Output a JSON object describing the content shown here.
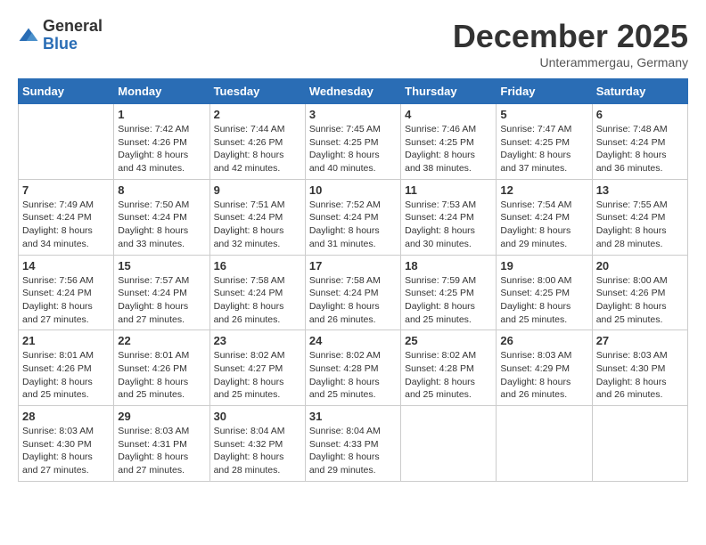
{
  "logo": {
    "general": "General",
    "blue": "Blue"
  },
  "title": "December 2025",
  "subtitle": "Unterammergau, Germany",
  "weekdays": [
    "Sunday",
    "Monday",
    "Tuesday",
    "Wednesday",
    "Thursday",
    "Friday",
    "Saturday"
  ],
  "weeks": [
    [
      {
        "day": "",
        "info": ""
      },
      {
        "day": "1",
        "info": "Sunrise: 7:42 AM\nSunset: 4:26 PM\nDaylight: 8 hours\nand 43 minutes."
      },
      {
        "day": "2",
        "info": "Sunrise: 7:44 AM\nSunset: 4:26 PM\nDaylight: 8 hours\nand 42 minutes."
      },
      {
        "day": "3",
        "info": "Sunrise: 7:45 AM\nSunset: 4:25 PM\nDaylight: 8 hours\nand 40 minutes."
      },
      {
        "day": "4",
        "info": "Sunrise: 7:46 AM\nSunset: 4:25 PM\nDaylight: 8 hours\nand 38 minutes."
      },
      {
        "day": "5",
        "info": "Sunrise: 7:47 AM\nSunset: 4:25 PM\nDaylight: 8 hours\nand 37 minutes."
      },
      {
        "day": "6",
        "info": "Sunrise: 7:48 AM\nSunset: 4:24 PM\nDaylight: 8 hours\nand 36 minutes."
      }
    ],
    [
      {
        "day": "7",
        "info": "Sunrise: 7:49 AM\nSunset: 4:24 PM\nDaylight: 8 hours\nand 34 minutes."
      },
      {
        "day": "8",
        "info": "Sunrise: 7:50 AM\nSunset: 4:24 PM\nDaylight: 8 hours\nand 33 minutes."
      },
      {
        "day": "9",
        "info": "Sunrise: 7:51 AM\nSunset: 4:24 PM\nDaylight: 8 hours\nand 32 minutes."
      },
      {
        "day": "10",
        "info": "Sunrise: 7:52 AM\nSunset: 4:24 PM\nDaylight: 8 hours\nand 31 minutes."
      },
      {
        "day": "11",
        "info": "Sunrise: 7:53 AM\nSunset: 4:24 PM\nDaylight: 8 hours\nand 30 minutes."
      },
      {
        "day": "12",
        "info": "Sunrise: 7:54 AM\nSunset: 4:24 PM\nDaylight: 8 hours\nand 29 minutes."
      },
      {
        "day": "13",
        "info": "Sunrise: 7:55 AM\nSunset: 4:24 PM\nDaylight: 8 hours\nand 28 minutes."
      }
    ],
    [
      {
        "day": "14",
        "info": "Sunrise: 7:56 AM\nSunset: 4:24 PM\nDaylight: 8 hours\nand 27 minutes."
      },
      {
        "day": "15",
        "info": "Sunrise: 7:57 AM\nSunset: 4:24 PM\nDaylight: 8 hours\nand 27 minutes."
      },
      {
        "day": "16",
        "info": "Sunrise: 7:58 AM\nSunset: 4:24 PM\nDaylight: 8 hours\nand 26 minutes."
      },
      {
        "day": "17",
        "info": "Sunrise: 7:58 AM\nSunset: 4:24 PM\nDaylight: 8 hours\nand 26 minutes."
      },
      {
        "day": "18",
        "info": "Sunrise: 7:59 AM\nSunset: 4:25 PM\nDaylight: 8 hours\nand 25 minutes."
      },
      {
        "day": "19",
        "info": "Sunrise: 8:00 AM\nSunset: 4:25 PM\nDaylight: 8 hours\nand 25 minutes."
      },
      {
        "day": "20",
        "info": "Sunrise: 8:00 AM\nSunset: 4:26 PM\nDaylight: 8 hours\nand 25 minutes."
      }
    ],
    [
      {
        "day": "21",
        "info": "Sunrise: 8:01 AM\nSunset: 4:26 PM\nDaylight: 8 hours\nand 25 minutes."
      },
      {
        "day": "22",
        "info": "Sunrise: 8:01 AM\nSunset: 4:26 PM\nDaylight: 8 hours\nand 25 minutes."
      },
      {
        "day": "23",
        "info": "Sunrise: 8:02 AM\nSunset: 4:27 PM\nDaylight: 8 hours\nand 25 minutes."
      },
      {
        "day": "24",
        "info": "Sunrise: 8:02 AM\nSunset: 4:28 PM\nDaylight: 8 hours\nand 25 minutes."
      },
      {
        "day": "25",
        "info": "Sunrise: 8:02 AM\nSunset: 4:28 PM\nDaylight: 8 hours\nand 25 minutes."
      },
      {
        "day": "26",
        "info": "Sunrise: 8:03 AM\nSunset: 4:29 PM\nDaylight: 8 hours\nand 26 minutes."
      },
      {
        "day": "27",
        "info": "Sunrise: 8:03 AM\nSunset: 4:30 PM\nDaylight: 8 hours\nand 26 minutes."
      }
    ],
    [
      {
        "day": "28",
        "info": "Sunrise: 8:03 AM\nSunset: 4:30 PM\nDaylight: 8 hours\nand 27 minutes."
      },
      {
        "day": "29",
        "info": "Sunrise: 8:03 AM\nSunset: 4:31 PM\nDaylight: 8 hours\nand 27 minutes."
      },
      {
        "day": "30",
        "info": "Sunrise: 8:04 AM\nSunset: 4:32 PM\nDaylight: 8 hours\nand 28 minutes."
      },
      {
        "day": "31",
        "info": "Sunrise: 8:04 AM\nSunset: 4:33 PM\nDaylight: 8 hours\nand 29 minutes."
      },
      {
        "day": "",
        "info": ""
      },
      {
        "day": "",
        "info": ""
      },
      {
        "day": "",
        "info": ""
      }
    ]
  ]
}
